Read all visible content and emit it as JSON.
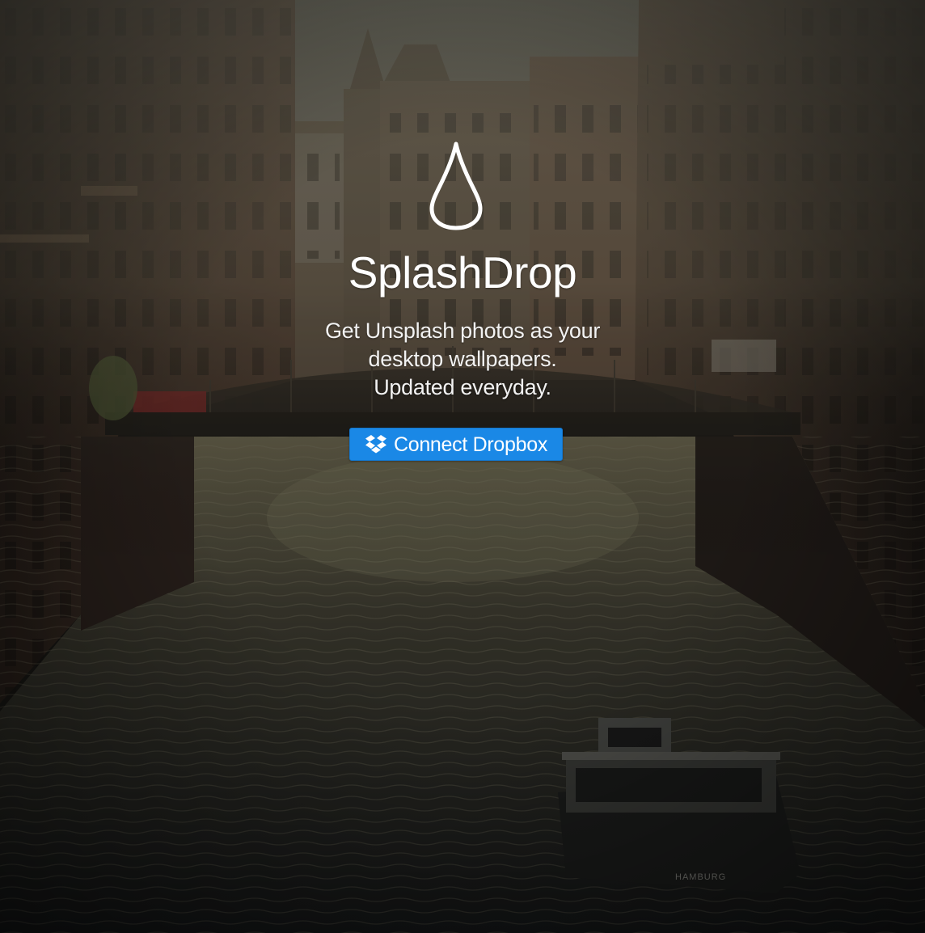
{
  "app": {
    "title": "SplashDrop",
    "logo_icon": "water-drop-icon"
  },
  "tagline": {
    "lines": [
      "Get Unsplash photos as your",
      "desktop wallpapers.",
      "Updated everyday."
    ]
  },
  "connect": {
    "label": "Connect Dropbox",
    "icon": "dropbox-icon",
    "color": "#1a88e6"
  },
  "background": {
    "description_icon": "canal-photo-background",
    "boat_text": "HAMBURG"
  },
  "colors": {
    "text": "#ffffff",
    "accent": "#1a88e6"
  }
}
